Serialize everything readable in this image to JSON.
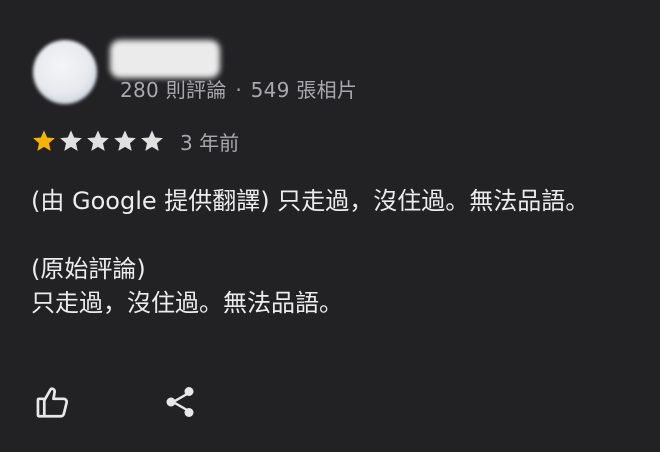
{
  "reviewer": {
    "stats": {
      "reviews": "280 則評論",
      "separator": "·",
      "photos": "549 張相片"
    }
  },
  "rating": {
    "value": 1,
    "max": 5,
    "filled_color": "#f4b400",
    "empty_color": "#e0e0e0",
    "time_ago": "3 年前"
  },
  "review": {
    "translated_line": "(由 Google 提供翻譯) 只走過，沒住過。無法品語。",
    "original_heading": "(原始評論)",
    "original_text": "只走過，沒住過。無法品語。"
  },
  "actions": {
    "like_icon": "thumbs-up-icon",
    "share_icon": "share-icon"
  }
}
